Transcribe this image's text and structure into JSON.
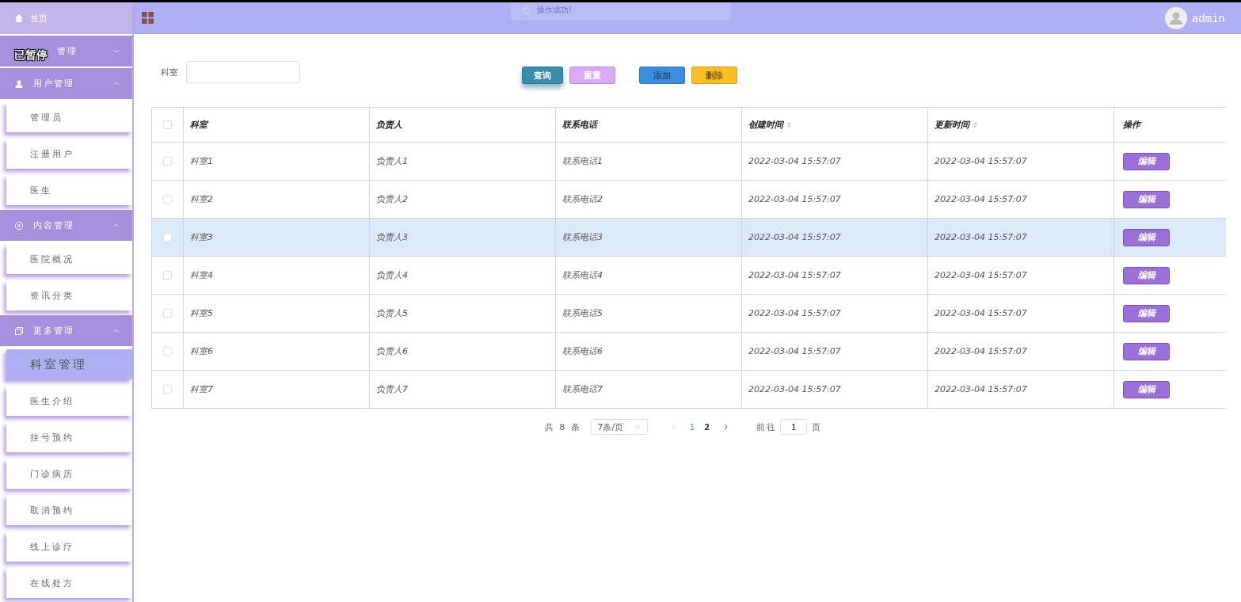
{
  "overlay_label": "已暂停",
  "toast": {
    "text": "操作成功!"
  },
  "sidebar": {
    "home": {
      "label": "首页"
    },
    "groups": [
      {
        "label": "管理",
        "expanded": false
      },
      {
        "label": "用户管理",
        "expanded": true,
        "children": [
          {
            "label": "管理员",
            "selected": false
          },
          {
            "label": "注册用户",
            "selected": false
          },
          {
            "label": "医生",
            "selected": false
          }
        ]
      },
      {
        "label": "内容管理",
        "expanded": true,
        "children": [
          {
            "label": "医院概况",
            "selected": false
          },
          {
            "label": "资讯分类",
            "selected": false
          }
        ]
      },
      {
        "label": "更多管理",
        "expanded": true,
        "children": [
          {
            "label": "科室管理",
            "selected": true
          },
          {
            "label": "医生介绍",
            "selected": false
          },
          {
            "label": "挂号预约",
            "selected": false
          },
          {
            "label": "门诊病历",
            "selected": false
          },
          {
            "label": "取消预约",
            "selected": false
          },
          {
            "label": "线上诊疗",
            "selected": false
          },
          {
            "label": "在线处方",
            "selected": false
          }
        ]
      }
    ]
  },
  "header": {
    "user": "admin"
  },
  "search": {
    "label": "科室"
  },
  "buttons": [
    {
      "label": "查询",
      "color": "#3a8caf"
    },
    {
      "label": "重置",
      "color": "#d9a8f7"
    },
    {
      "label": "添加",
      "color": "#3b8de0"
    },
    {
      "label": "删除",
      "color": "#fbbf24"
    }
  ],
  "table": {
    "all_checked": false,
    "columns": [
      {
        "label": "科室",
        "kind": "plain"
      },
      {
        "label": "负责人",
        "kind": "plain"
      },
      {
        "label": "联系电话",
        "kind": "plain"
      },
      {
        "label": "创建时间",
        "kind": "sortable"
      },
      {
        "label": "更新时间",
        "kind": "sortable"
      },
      {
        "label": "操作",
        "kind": "plain"
      }
    ],
    "rows": [
      {
        "checked": false,
        "highlighted": false,
        "cells": [
          "科室1",
          "负责人1",
          "联系电话1",
          "2022-03-04 15:57:07",
          "2022-03-04 15:57:07"
        ],
        "action": "编辑"
      },
      {
        "checked": false,
        "highlighted": false,
        "cells": [
          "科室2",
          "负责人2",
          "联系电话2",
          "2022-03-04 15:57:07",
          "2022-03-04 15:57:07"
        ],
        "action": "编辑"
      },
      {
        "checked": false,
        "highlighted": true,
        "cells": [
          "科室3",
          "负责人3",
          "联系电话3",
          "2022-03-04 15:57:07",
          "2022-03-04 15:57:07"
        ],
        "action": "编辑"
      },
      {
        "checked": false,
        "highlighted": false,
        "cells": [
          "科室4",
          "负责人4",
          "联系电话4",
          "2022-03-04 15:57:07",
          "2022-03-04 15:57:07"
        ],
        "action": "编辑"
      },
      {
        "checked": false,
        "highlighted": false,
        "cells": [
          "科室5",
          "负责人5",
          "联系电话5",
          "2022-03-04 15:57:07",
          "2022-03-04 15:57:07"
        ],
        "action": "编辑"
      },
      {
        "checked": false,
        "highlighted": false,
        "cells": [
          "科室6",
          "负责人6",
          "联系电话6",
          "2022-03-04 15:57:07",
          "2022-03-04 15:57:07"
        ],
        "action": "编辑"
      },
      {
        "checked": false,
        "highlighted": false,
        "cells": [
          "科室7",
          "负责人7",
          "联系电话7",
          "2022-03-04 15:57:07",
          "2022-03-04 15:57:07"
        ],
        "action": "编辑"
      }
    ]
  },
  "pagination": {
    "total": "共 8 条",
    "page_size": "7条/页",
    "pages": [
      {
        "label": "1",
        "selected": true
      },
      {
        "label": "2",
        "selected": false
      }
    ],
    "goto_label": "前往",
    "goto_value": "1",
    "goto_suffix": "页"
  }
}
